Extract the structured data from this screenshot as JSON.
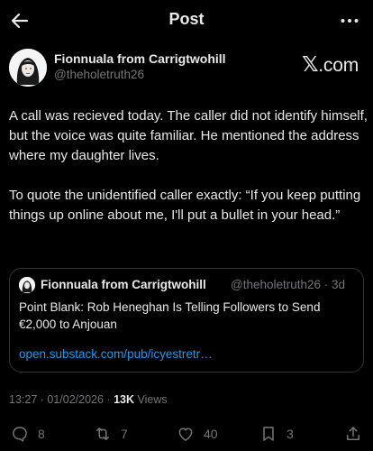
{
  "header": {
    "title": "Post",
    "back_icon": "arrow-left-icon",
    "more_icon": "more-horizontal-icon"
  },
  "author": {
    "name": "Fionnuala from Carrigtwohill",
    "handle": "@theholetruth26",
    "source": ".com"
  },
  "post": {
    "paragraph1": "A call was recieved today. The caller did not identify himself, but the voice was quite familiar. He mentioned the address where my daughter lives.",
    "paragraph2": "To quote the unidentified caller exactly: “If you keep putting things up online about me, I'll put a bullet in your head.”"
  },
  "quote": {
    "name": "Fionnuala from Carrigtwohill",
    "meta": "@theholetruth26 · 3d",
    "title": "Point Blank: Rob Heneghan Is Telling Followers to Send €2,000 to Anjouan",
    "link": "open.substack.com/pub/icyestretr…"
  },
  "meta": {
    "timestamp": "13:27 · 01/02/2026 · ",
    "views_count": "13K",
    "views_label": " Views"
  },
  "actions": {
    "reply_count": "8",
    "repost_count": "7",
    "like_count": "40",
    "bookmark_count": "3"
  },
  "colors": {
    "background": "#000000",
    "text": "#e7e9ea",
    "secondary": "#71767b",
    "link": "#1d9bf0",
    "border": "#2f3336"
  }
}
